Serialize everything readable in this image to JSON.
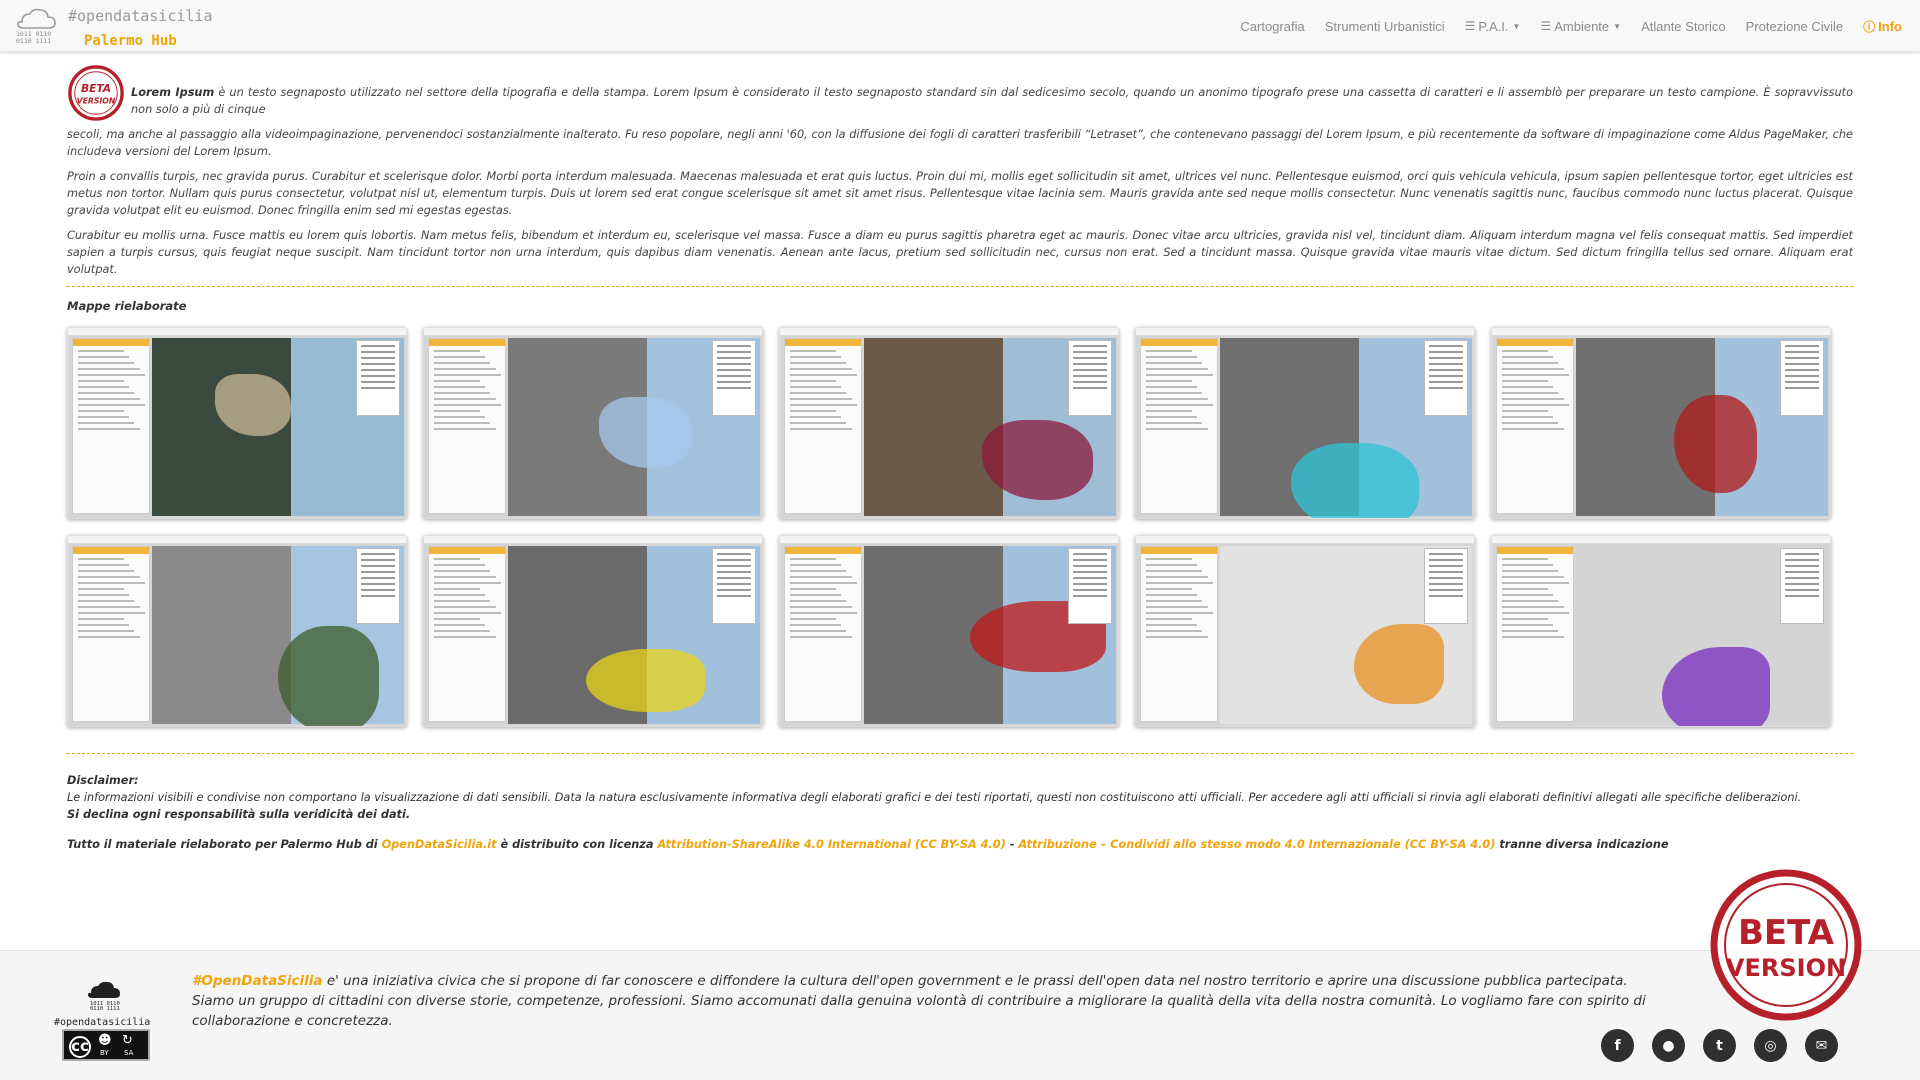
{
  "brand": {
    "hashtag": "#opendatasicilia",
    "name": "Palermo Hub"
  },
  "nav": {
    "items": [
      {
        "label": "Cartografia",
        "icon": "",
        "dropdown": false
      },
      {
        "label": "Strumenti Urbanistici",
        "icon": "",
        "dropdown": false
      },
      {
        "label": "P.A.I.",
        "icon": "list-icon",
        "dropdown": true
      },
      {
        "label": "Ambiente",
        "icon": "list-icon",
        "dropdown": true
      },
      {
        "label": "Atlante Storico",
        "icon": "",
        "dropdown": false
      },
      {
        "label": "Protezione Civile",
        "icon": "",
        "dropdown": false
      }
    ],
    "info_label": "Info"
  },
  "beta_badge": {
    "line1": "BETA",
    "line2": "VERSION"
  },
  "intro": {
    "lead_bold": "Lorem Ipsum",
    "p1_rest_a": " è un testo segnaposto utilizzato nel settore della tipografia e della stampa. Lorem Ipsum è considerato il testo segnaposto standard sin dal sedicesimo secolo, quando un anonimo tipografo prese una cassetta di caratteri e li assemblò per preparare un testo campione. È sopravvissuto non solo a più di cinque",
    "p1_rest_b": "secoli, ma anche al passaggio alla videoimpaginazione, pervenendoci sostanzialmente inalterato. Fu reso popolare, negli anni '60, con la diffusione dei fogli di caratteri trasferibili “Letraset”, che contenevano passaggi del Lorem Ipsum, e più recentemente da software di impaginazione come Aldus PageMaker, che includeva versioni del Lorem Ipsum.",
    "p2": "Proin a convallis turpis, nec gravida purus. Curabitur et scelerisque dolor. Morbi porta interdum malesuada. Maecenas malesuada et erat quis luctus. Proin dui mi, mollis eget sollicitudin sit amet, ultrices vel nunc. Pellentesque euismod, orci quis vehicula vehicula, ipsum sapien pellentesque tortor, eget ultricies est metus non tortor. Nullam quis purus consectetur, volutpat nisl ut, elementum turpis. Duis ut lorem sed erat congue scelerisque sit amet sit amet risus. Pellentesque vitae lacinia sem. Mauris gravida ante sed neque mollis consectetur. Nunc venenatis sagittis nunc, faucibus commodo nunc luctus placerat. Quisque gravida volutpat elit eu euismod. Donec fringilla enim sed mi egestas egestas.",
    "p3": "Curabitur eu mollis urna. Fusce mattis eu lorem quis lobortis. Nam metus felis, bibendum et interdum eu, scelerisque vel massa. Fusce a diam eu purus sagittis pharetra eget ac mauris. Donec vitae arcu ultricies, gravida nisl vel, tincidunt diam. Aliquam interdum magna vel felis consequat mattis. Sed imperdiet sapien a turpis cursus, quis feugiat neque suscipit. Nam tincidunt tortor non urna interdum, quis dapibus diam venenatis. Aenean ante lacus, pretium sed sollicitudin nec, cursus non erat. Sed a tincidunt massa. Quisque gravida vitae mauris vitae dictum. Sed dictum fringilla tellus sed ornare. Aliquam erat volutpat."
  },
  "maps_section": {
    "title": "Mappe rielaborate",
    "thumbnails": [
      {
        "base": "#3b4a3f",
        "accent": "#c9b89a"
      },
      {
        "base": "#7a7a7a",
        "accent": "#a6c8ec"
      },
      {
        "base": "#6b5a4a",
        "accent": "#8b1a3a"
      },
      {
        "base": "#6f6f6f",
        "accent": "#2ec4d6"
      },
      {
        "base": "#707070",
        "accent": "#b01a1a"
      },
      {
        "base": "#8a8a8a",
        "accent": "#3d5a2a"
      },
      {
        "base": "#6a6a6a",
        "accent": "#e8d41a"
      },
      {
        "base": "#6e6e6e",
        "accent": "#c01818"
      },
      {
        "base": "#e2e2e2",
        "accent": "#e89020"
      },
      {
        "base": "#d4d4d4",
        "accent": "#7a2bbf"
      }
    ]
  },
  "disclaimer": {
    "title": "Disclaimer:",
    "text": "Le informazioni visibili e condivise non comportano la visualizzazione di dati sensibili. Data la natura esclusivamente informativa degli elaborati grafici e dei testi riportati, questi non costituiscono atti ufficiali. Per accedere agli atti ufficiali si rinvia agli elaborati definitivi allegati alle specifiche deliberazioni.",
    "bold": "Si declina ogni responsabilità sulla veridicità dei dati."
  },
  "license": {
    "prefix": "Tutto il materiale rielaborato per Palermo Hub di ",
    "link1": "OpenDataSicilia.it",
    "middle": " è distribuito con licenza ",
    "link2": "Attribution-ShareAlike 4.0 International (CC BY-SA 4.0)",
    "sep": " - ",
    "link3": "Attribuzione – Condividi allo stesso modo 4.0 Internazionale (CC BY-SA 4.0)",
    "suffix": " tranne diversa indicazione"
  },
  "footer": {
    "logo_tag": "#opendatasicilia",
    "brand": "#OpenDataSicilia",
    "line1_rest": " e' una iniziativa civica che si propone di far conoscere e diffondere la cultura dell'open government e le prassi dell'open data nel nostro territorio e aprire una discussione pubblica partecipata.",
    "line2": "Siamo un gruppo di cittadini con diverse storie, competenze, professioni. Siamo accomunati dalla genuina volontà di contribuire a migliorare la qualità della vita della nostra comunità. Lo vogliamo fare con spirito di collaborazione e concretezza.",
    "cc": {
      "cc": "cc",
      "by": "BY",
      "sa": "SA"
    },
    "socials": [
      {
        "name": "facebook-icon",
        "glyph": "f"
      },
      {
        "name": "github-icon",
        "glyph": "●"
      },
      {
        "name": "twitter-icon",
        "glyph": "t"
      },
      {
        "name": "globe-icon",
        "glyph": "◎"
      },
      {
        "name": "email-icon",
        "glyph": "✉"
      }
    ]
  },
  "colors": {
    "accent": "#f0a30a",
    "stamp_red": "#b5202a",
    "footer_bg": "#f5f5f5"
  }
}
